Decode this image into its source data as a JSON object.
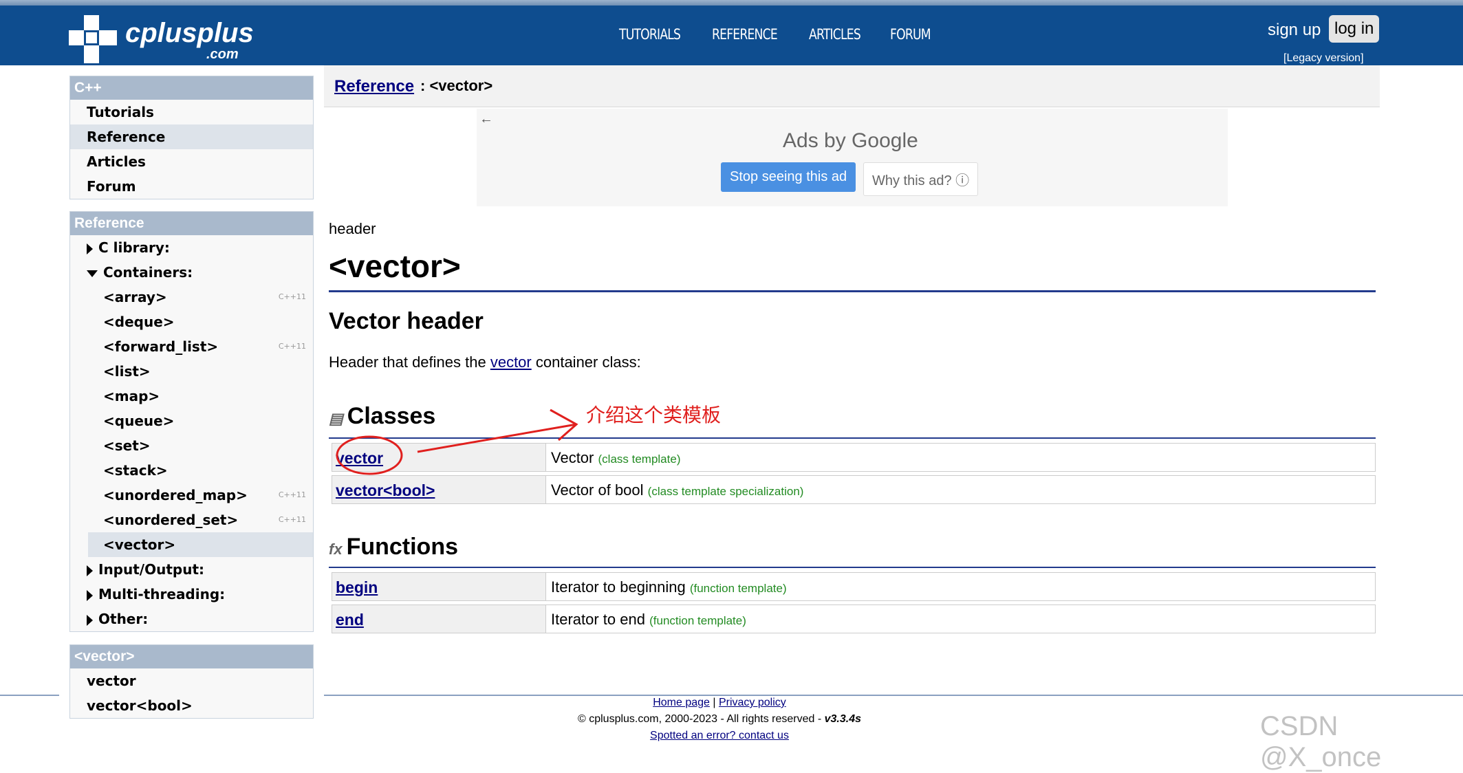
{
  "site": {
    "brand": "cplusplus",
    "brand_suffix": ".com",
    "nav": [
      "TUTORIALS",
      "REFERENCE",
      "ARTICLES",
      "FORUM"
    ],
    "sign_up": "sign up",
    "log_in": "log in",
    "legacy": "[Legacy version]"
  },
  "sidebar_cpp": {
    "heading": "C++",
    "items": [
      "Tutorials",
      "Reference",
      "Articles",
      "Forum"
    ],
    "selected": "Reference"
  },
  "sidebar_ref": {
    "heading": "Reference",
    "c_library": "C library:",
    "containers": "Containers:",
    "container_items": [
      {
        "label": "<array>",
        "tag": "C++11"
      },
      {
        "label": "<deque>",
        "tag": ""
      },
      {
        "label": "<forward_list>",
        "tag": "C++11"
      },
      {
        "label": "<list>",
        "tag": ""
      },
      {
        "label": "<map>",
        "tag": ""
      },
      {
        "label": "<queue>",
        "tag": ""
      },
      {
        "label": "<set>",
        "tag": ""
      },
      {
        "label": "<stack>",
        "tag": ""
      },
      {
        "label": "<unordered_map>",
        "tag": "C++11"
      },
      {
        "label": "<unordered_set>",
        "tag": "C++11"
      },
      {
        "label": "<vector>",
        "tag": ""
      }
    ],
    "input_output": "Input/Output:",
    "multithreading": "Multi-threading:",
    "other": "Other:"
  },
  "sidebar_vector": {
    "heading": "<vector>",
    "items": [
      "vector",
      "vector<bool>"
    ]
  },
  "breadcrumb": {
    "link": "Reference",
    "rest": " : <vector>"
  },
  "ad": {
    "back": "←",
    "ads_by": "Ads by Google",
    "stop": "Stop seeing this ad",
    "why": "Why this ad? ⓘ"
  },
  "content": {
    "label": "header",
    "title": "<vector>",
    "subtitle": "Vector header",
    "desc_before": "Header that defines the ",
    "desc_link": "vector",
    "desc_after": " container class:",
    "classes_heading": "Classes",
    "classes": [
      {
        "name": "vector",
        "desc": "Vector",
        "kind": "(class template)"
      },
      {
        "name": "vector<bool>",
        "desc": "Vector of bool",
        "kind": "(class template specialization)"
      }
    ],
    "functions_heading": "Functions",
    "functions_icon": "fx",
    "functions": [
      {
        "name": "begin",
        "desc": "Iterator to beginning",
        "kind": "(function template)"
      },
      {
        "name": "end",
        "desc": "Iterator to end",
        "kind": "(function template)"
      }
    ]
  },
  "annotation": {
    "note": "介绍这个类模板",
    "color": "#e0201e"
  },
  "footer": {
    "home": "Home page",
    "sep": " | ",
    "privacy": "Privacy policy",
    "copyright": "© cplusplus.com, 2000-2023 - All rights reserved - ",
    "version": "v3.3.4s",
    "spotted": "Spotted an error? contact us"
  },
  "watermark": "CSDN @X_once"
}
